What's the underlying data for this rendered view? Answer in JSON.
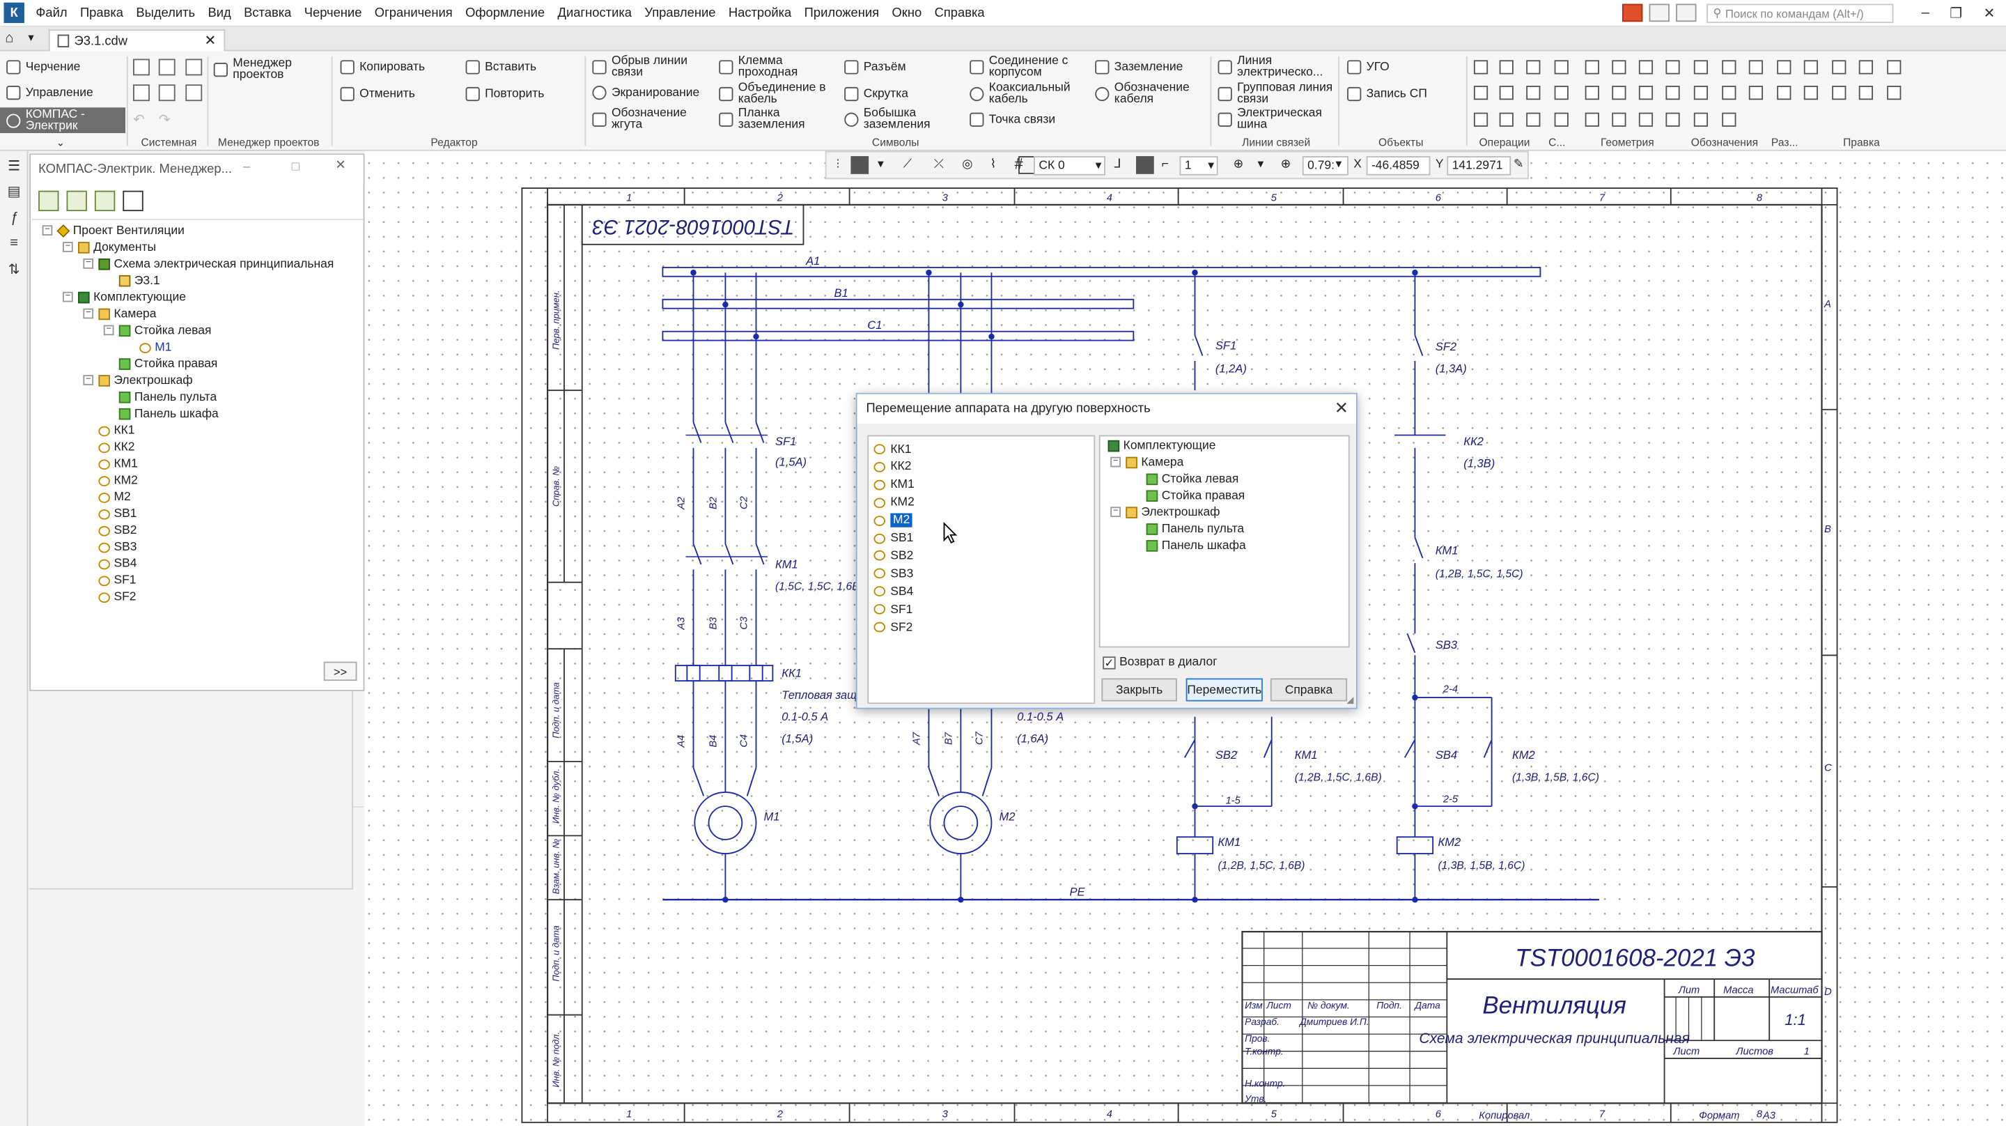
{
  "menu": [
    "Файл",
    "Правка",
    "Выделить",
    "Вид",
    "Вставка",
    "Черчение",
    "Ограничения",
    "Оформление",
    "Диагностика",
    "Управление",
    "Настройка",
    "Приложения",
    "Окно",
    "Справка"
  ],
  "search_placeholder": "Поиск по командам (Alt+/)",
  "doc_tab": "Э3.1.cdw",
  "modes": {
    "m1": "Черчение",
    "m2": "Управление",
    "m3": "КОМПАС - Электрик"
  },
  "ribbon": {
    "manager": "Менеджер проектов",
    "copy": "Копировать",
    "paste": "Вставить",
    "cancel": "Отменить",
    "repeat": "Повторить",
    "b1": "Обрыв линии связи",
    "b2": "Экранирование",
    "b3": "Обозначение жгута",
    "b4": "Клемма проходная",
    "b5": "Объединение в кабель",
    "b6": "Планка заземления",
    "b7": "Разъём",
    "b8": "Скрутка",
    "b9": "Бобышка заземления",
    "b10": "Соединение с корпусом",
    "b11": "Коаксиальный кабель",
    "b12": "Точка связи",
    "b13": "Заземление",
    "b14": "Обозначение кабеля",
    "b15": "Линия электрическо...",
    "b16": "Групповая линия связи",
    "b17": "Электрическая шина",
    "b18": "УГО",
    "b19": "Запись СП",
    "groups": {
      "g1": "Системная",
      "g2": "Менеджер проектов",
      "g3": "Редактор",
      "g4": "Символы",
      "g5": "Линии связей",
      "g6": "Объекты",
      "g7": "Операции",
      "g8": "С...",
      "g9": "Геометрия",
      "g10": "Обозначения",
      "g11": "Раз...",
      "g12": "Правка"
    }
  },
  "view_toolbar": {
    "sk": "СК 0",
    "layer": "1",
    "zoom": "0.79:",
    "x_label": "X",
    "x": "-46.4859",
    "y_label": "Y",
    "y": "141.2971"
  },
  "panel": {
    "title": "КОМПАС-Электрик. Менеджер...",
    "more": ">>",
    "tree": {
      "project": "Проект Вентиляции",
      "docs": "Документы",
      "schema": "Схема электрическая принципиальная",
      "e31": "Э3.1",
      "kit": "Комплектующие",
      "camera": "Камера",
      "left": "Стойка левая",
      "m1": "М1",
      "right": "Стойка правая",
      "cab": "Электрошкаф",
      "p1": "Панель пульта",
      "p2": "Панель шкафа",
      "devices": [
        "КК1",
        "КК2",
        "КМ1",
        "КМ2",
        "М2",
        "SB1",
        "SB2",
        "SB3",
        "SB4",
        "SF1",
        "SF2"
      ]
    }
  },
  "dialog": {
    "title": "Перемещение аппарата на другую поверхность",
    "devices": [
      "КК1",
      "КК2",
      "КМ1",
      "КМ2",
      "М2",
      "SB1",
      "SB2",
      "SB3",
      "SB4",
      "SF1",
      "SF2"
    ],
    "selected_index": 4,
    "tree": {
      "root": "Комплектующие",
      "camera": "Камера",
      "left": "Стойка левая",
      "right": "Стойка правая",
      "cab": "Электрошкаф",
      "p1": "Панель пульта",
      "p2": "Панель шкафа"
    },
    "checkbox": "Возврат в диалог",
    "close": "Закрыть",
    "move": "Переместить",
    "help": "Справка"
  },
  "drawing": {
    "stamp_code": "TST0001608-2021 Э3",
    "title": "Вентиляция",
    "subtitle": "Схема электрическая принципиальная",
    "lit_label": "Лит",
    "mass_label": "Масса",
    "scale_label": "Масштаб",
    "scale": "1:1",
    "sheet_label": "Лист",
    "sheets_label": "Листов",
    "sheets": "1",
    "copied": "Копировал",
    "format": "Формат",
    "format_value": "A3",
    "stamp_rows": {
      "izm": "Изм",
      "list": "Лист",
      "ndoc": "№ докум.",
      "podp": "Подп.",
      "data": "Дата",
      "razrab": "Разраб.",
      "razrab_name": "Дмитриев И.П.",
      "prov": "Пров.",
      "tkontr": "Т.контр.",
      "nkontr": "Н.контр.",
      "utv": "Утв."
    },
    "left_strip": [
      "Перв. примен.",
      "Справ. №",
      "Подп. и дата",
      "Инв. № дубл.",
      "Взам. инв. №",
      "Подп. и дата",
      "Инв. № подл."
    ],
    "buses": [
      "A1",
      "B1",
      "C1",
      "PE"
    ],
    "zones_top": [
      "1",
      "2",
      "3",
      "4",
      "5",
      "6",
      "7",
      "8"
    ],
    "zones_right": [
      "A",
      "B",
      "C",
      "D"
    ],
    "labels": {
      "sf1": "SF1",
      "sf1_val": "(1,5А)",
      "km1": "КМ1",
      "km1_ref": "(1,5С, 1,5С, 1,6В)",
      "kk1": "КК1",
      "kk1_note": "Тепловая защ...",
      "kk1_range": "0.1-0.5 А",
      "kk1_val": "(1,5А)",
      "m1": "М1",
      "m2": "М2",
      "kk2_range": "0.1-0.5 А",
      "kk2_val": "(1,6А)",
      "sf1b": "SF1",
      "sf1b_val": "(1,2А)",
      "sf2": "SF2",
      "sf2_val": "(1,3А)",
      "kk2": "КК2",
      "kk2_ref": "(1,3В)",
      "km1b": "КМ1",
      "km1b_ref": "(1,2В, 1,5С, 1,5С)",
      "sb3": "SB3",
      "sb2": "SB2",
      "km1c": "КМ1",
      "km1c_ref": "(1,2В, 1,5С, 1,6В)",
      "sb4": "SB4",
      "km2": "КМ2",
      "km2_ref": "(1,3В, 1,5В, 1,6С)",
      "km1coil": "КМ1",
      "km1coil_ref": "(1,2В, 1,5С, 1,6В)",
      "km2coil": "КМ2",
      "km2coil_ref": "(1,3В, 1,5В, 1,6С)",
      "w1": "1-5",
      "w2": "2-4",
      "w3": "2-5",
      "a2": "А2",
      "b2": "В2",
      "c2": "С2",
      "a3": "А3",
      "b3": "В3",
      "c3": "С3",
      "a4": "А4",
      "b4": "В4",
      "c4": "С4",
      "a7": "А7",
      "b7": "В7",
      "c7": "С7"
    }
  }
}
